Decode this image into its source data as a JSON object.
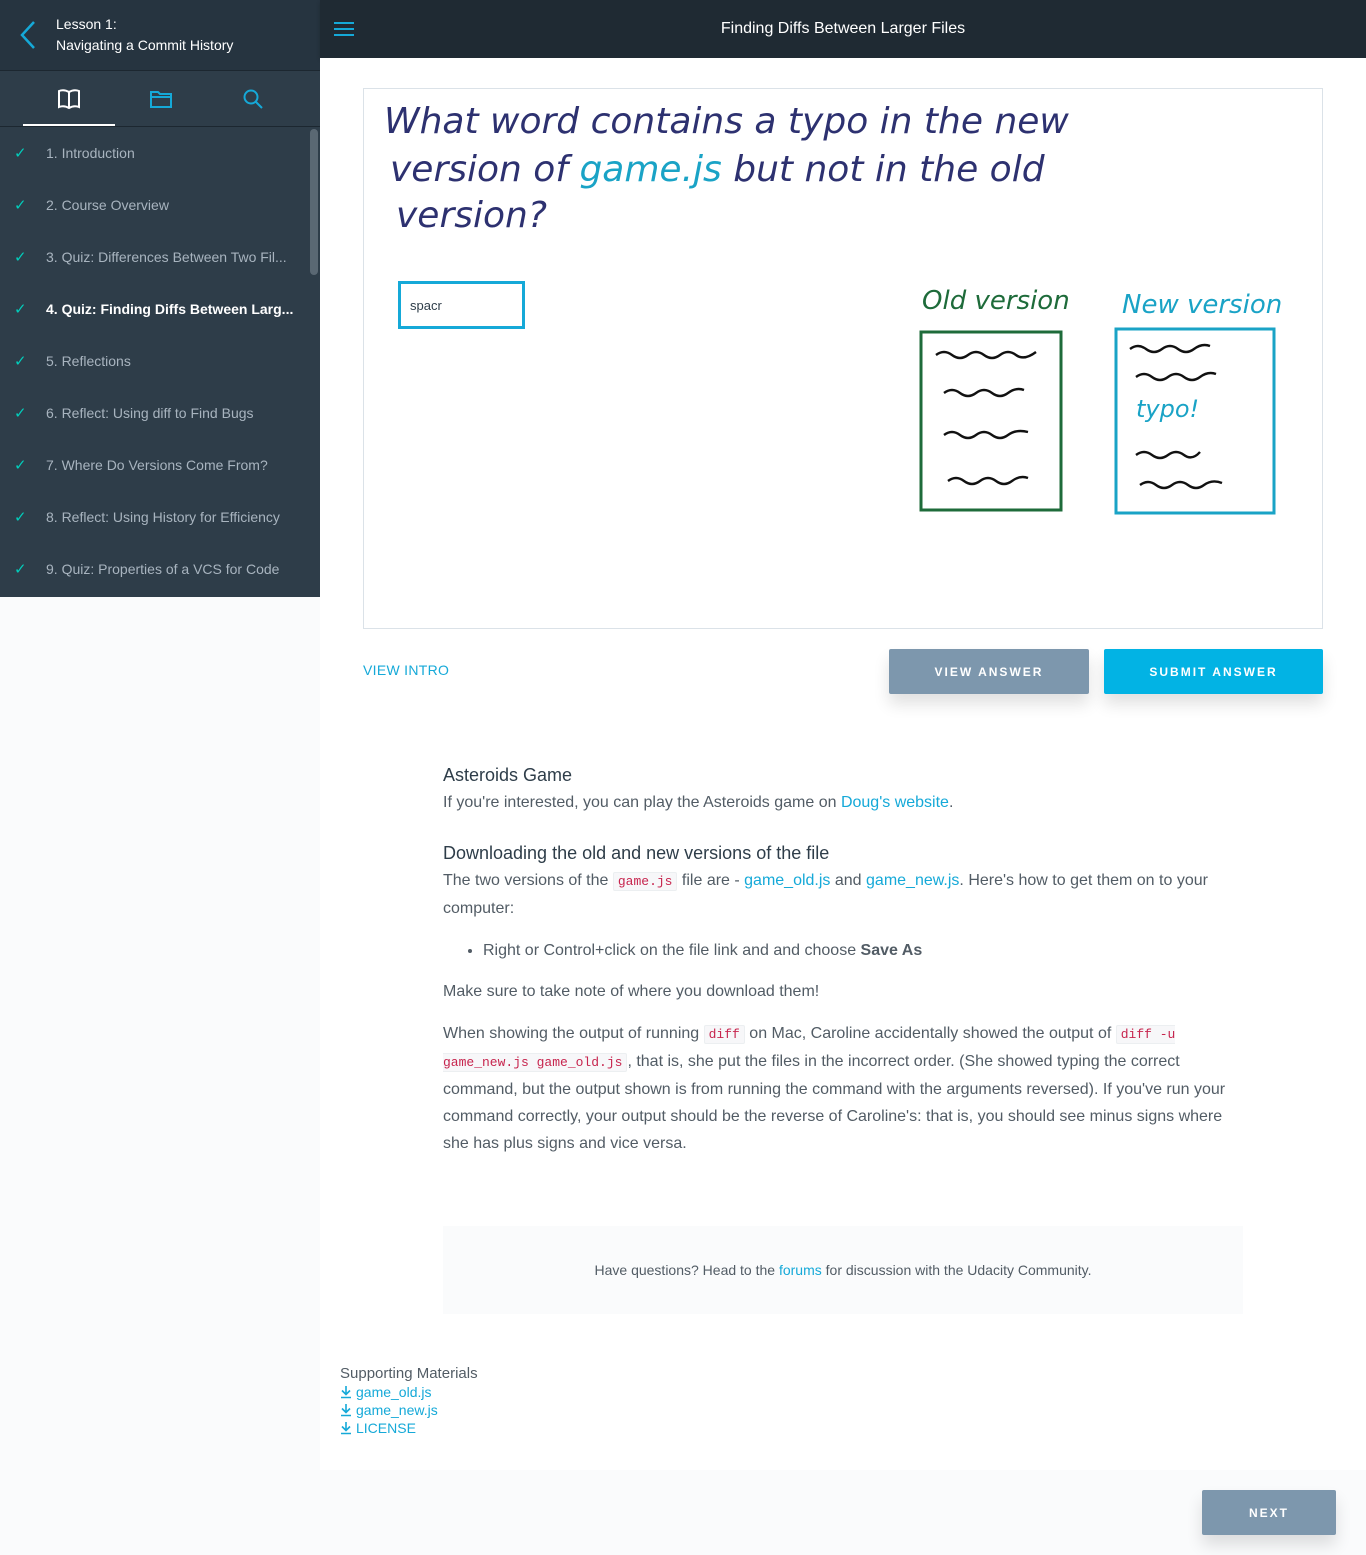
{
  "sidebar": {
    "lesson_number": "Lesson 1:",
    "lesson_title": "Navigating a Commit History",
    "tabs": [
      {
        "icon": "book-icon",
        "active": true
      },
      {
        "icon": "folder-icon",
        "active": false
      },
      {
        "icon": "search-icon",
        "active": false
      }
    ],
    "items": [
      {
        "label": "1. Introduction",
        "checked": true
      },
      {
        "label": "2. Course Overview",
        "checked": true
      },
      {
        "label": "3. Quiz: Differences Between Two Fil...",
        "checked": true
      },
      {
        "label": "4. Quiz: Finding Diffs Between Larg...",
        "checked": true,
        "active": true
      },
      {
        "label": "5. Reflections",
        "checked": true
      },
      {
        "label": "6. Reflect: Using diff to Find Bugs",
        "checked": true
      },
      {
        "label": "7. Where Do Versions Come From?",
        "checked": true
      },
      {
        "label": "8. Reflect: Using History for Efficiency",
        "checked": true
      },
      {
        "label": "9. Quiz: Properties of a VCS for Code",
        "checked": true
      }
    ]
  },
  "topbar": {
    "title": "Finding Diffs Between Larger Files"
  },
  "quiz": {
    "question_line1": "What word contains a typo in the new",
    "question_line2_a": "version of",
    "question_line2_code": "game.js",
    "question_line2_b": "but not in the old",
    "question_line3": "version?",
    "answer_value": "spacr",
    "old_label": "Old version",
    "new_label": "New version",
    "typo_label": "typo!"
  },
  "actions": {
    "view_intro": "VIEW INTRO",
    "view_answer": "VIEW ANSWER",
    "submit_answer": "SUBMIT ANSWER",
    "next": "NEXT"
  },
  "content": {
    "asteroids_heading": "Asteroids Game",
    "asteroids_text_a": "If you're interested, you can play the Asteroids game on ",
    "asteroids_link": "Doug's website",
    "asteroids_text_b": ".",
    "download_heading": "Downloading the old and new versions of the file",
    "download_text_a": "The two versions of the ",
    "download_code": "game.js",
    "download_text_b": " file are - ",
    "download_link_old": "game_old.js",
    "download_text_c": " and ",
    "download_link_new": "game_new.js",
    "download_text_d": ". Here's how to get them on to your computer:",
    "bullet_a": "Right or Control+click on the file link and and choose ",
    "bullet_bold": "Save As",
    "note": "Make sure to take note of where you download them!",
    "para_a": "When showing the output of running ",
    "para_code1": "diff",
    "para_b": " on Mac, Caroline accidentally showed the output of ",
    "para_code2": "diff -u game_new.js game_old.js",
    "para_c": ", that is, she put the files in the incorrect order. (She showed typing the correct command, but the output shown is from running the command with the arguments reversed). If you've run your command correctly, your output should be the reverse of Caroline's: that is, you should see minus signs where she has plus signs and vice versa."
  },
  "forum": {
    "text_a": "Have questions? Head to the ",
    "link": "forums",
    "text_b": " for discussion with the Udacity Community."
  },
  "supporting": {
    "title": "Supporting Materials",
    "files": [
      "game_old.js",
      "game_new.js",
      "LICENSE"
    ]
  },
  "colors": {
    "accent": "#15a9d8",
    "sidebar_bg": "#2e3d49",
    "topbar_bg": "#1f2a33",
    "check": "#02ccba",
    "old_version": "#1e6b3a",
    "new_version": "#1aa3c6",
    "button_gray": "#7d97ad",
    "button_blue": "#02b3e4"
  }
}
